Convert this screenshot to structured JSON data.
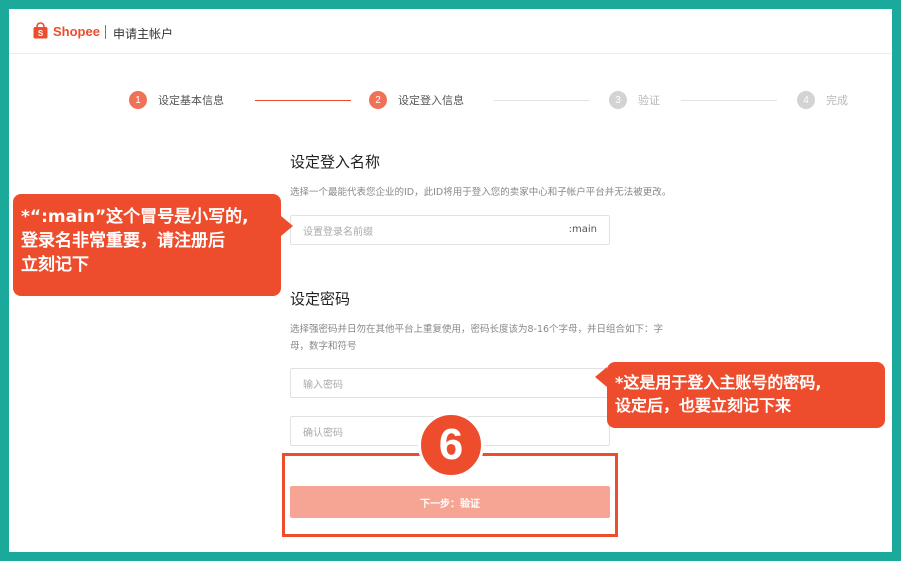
{
  "header": {
    "brand": "Shopee",
    "title": "申请主帐户"
  },
  "stepper": [
    {
      "num": "1",
      "label": "设定基本信息",
      "state": "done"
    },
    {
      "num": "2",
      "label": "设定登入信息",
      "state": "active"
    },
    {
      "num": "3",
      "label": "验证",
      "state": "inactive"
    },
    {
      "num": "4",
      "label": "完成",
      "state": "inactive"
    }
  ],
  "login": {
    "title": "设定登入名称",
    "help": "选择一个最能代表您企业的ID，此ID将用于登入您的卖家中心和子帐户平台并无法被更改。",
    "placeholder": "设置登录名前缀",
    "suffix": ":main"
  },
  "password": {
    "title": "设定密码",
    "help_line1": "选择强密码并日勿在其他平台上重复使用，密码长度该为8-16个字母，并日组合如下：字",
    "help_line2": "母，数字和符号",
    "placeholder": "输入密码",
    "confirm_placeholder": "确认密码"
  },
  "next_button": "下一步：验证",
  "annotations": {
    "step_badge": "6",
    "callout_left_line1": "*“:main”这个冒号是小写的,",
    "callout_left_line2": "登录名非常重要，请注册后",
    "callout_left_line3": "立刻记下",
    "callout_right_line1": "*这是用于登入主账号的密码,",
    "callout_right_line2": "设定后，也要立刻记下来"
  },
  "colors": {
    "brand": "#ee4d2d",
    "frame": "#1aa99b",
    "button": "#f6a595"
  }
}
